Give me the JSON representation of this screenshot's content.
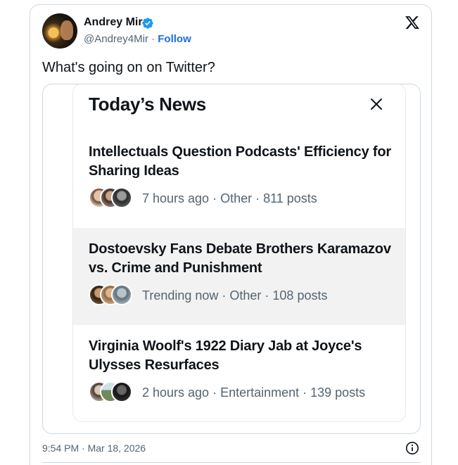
{
  "author": {
    "display_name": "Andrey Mir",
    "handle": "@Andrey4Mir",
    "separator": "·",
    "follow_label": "Follow"
  },
  "tweet": {
    "text": "What's going on on Twitter?",
    "timestamp": "9:54 PM · Mar 18, 2026"
  },
  "news_card": {
    "title": "Today’s News",
    "items": [
      {
        "headline": "Intellectuals Question Podcasts' Efficiency for Sharing Ideas",
        "meta": "7 hours ago · Other · 811 posts"
      },
      {
        "headline": "Dostoevsky Fans Debate Brothers Karamazov vs. Crime and Punishment",
        "meta": "Trending now · Other · 108 posts"
      },
      {
        "headline": "Virginia Woolf's 1922 Diary Jab at Joyce's Ulysses Resurfaces",
        "meta": "2 hours ago · Entertainment · 139 posts"
      }
    ]
  },
  "icons": {
    "verified": "verified-badge-icon",
    "x_logo": "x-logo-icon",
    "close": "close-icon",
    "info": "info-icon"
  },
  "colors": {
    "text_primary": "#0f1419",
    "text_secondary": "#536471",
    "link": "#1d6ed8",
    "verified": "#1d9bf0",
    "highlight_row": "#f2f2f2",
    "border": "#cfd9de"
  }
}
